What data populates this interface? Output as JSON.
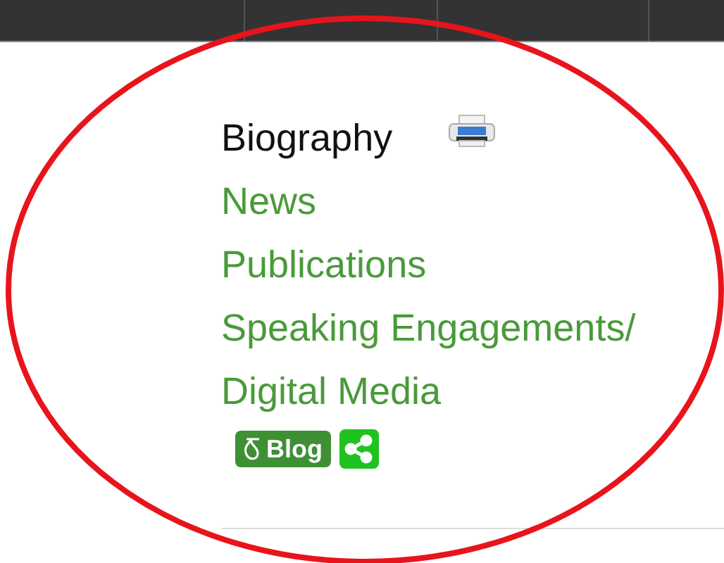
{
  "nav": {
    "items": [
      {
        "label": "Biography",
        "selected": true
      },
      {
        "label": "News",
        "selected": false
      },
      {
        "label": "Publications",
        "selected": false
      },
      {
        "label": "Speaking Engagements/",
        "selected": false
      },
      {
        "label": "Digital Media",
        "selected": false
      }
    ]
  },
  "blog_badge": {
    "label": "Blog"
  }
}
